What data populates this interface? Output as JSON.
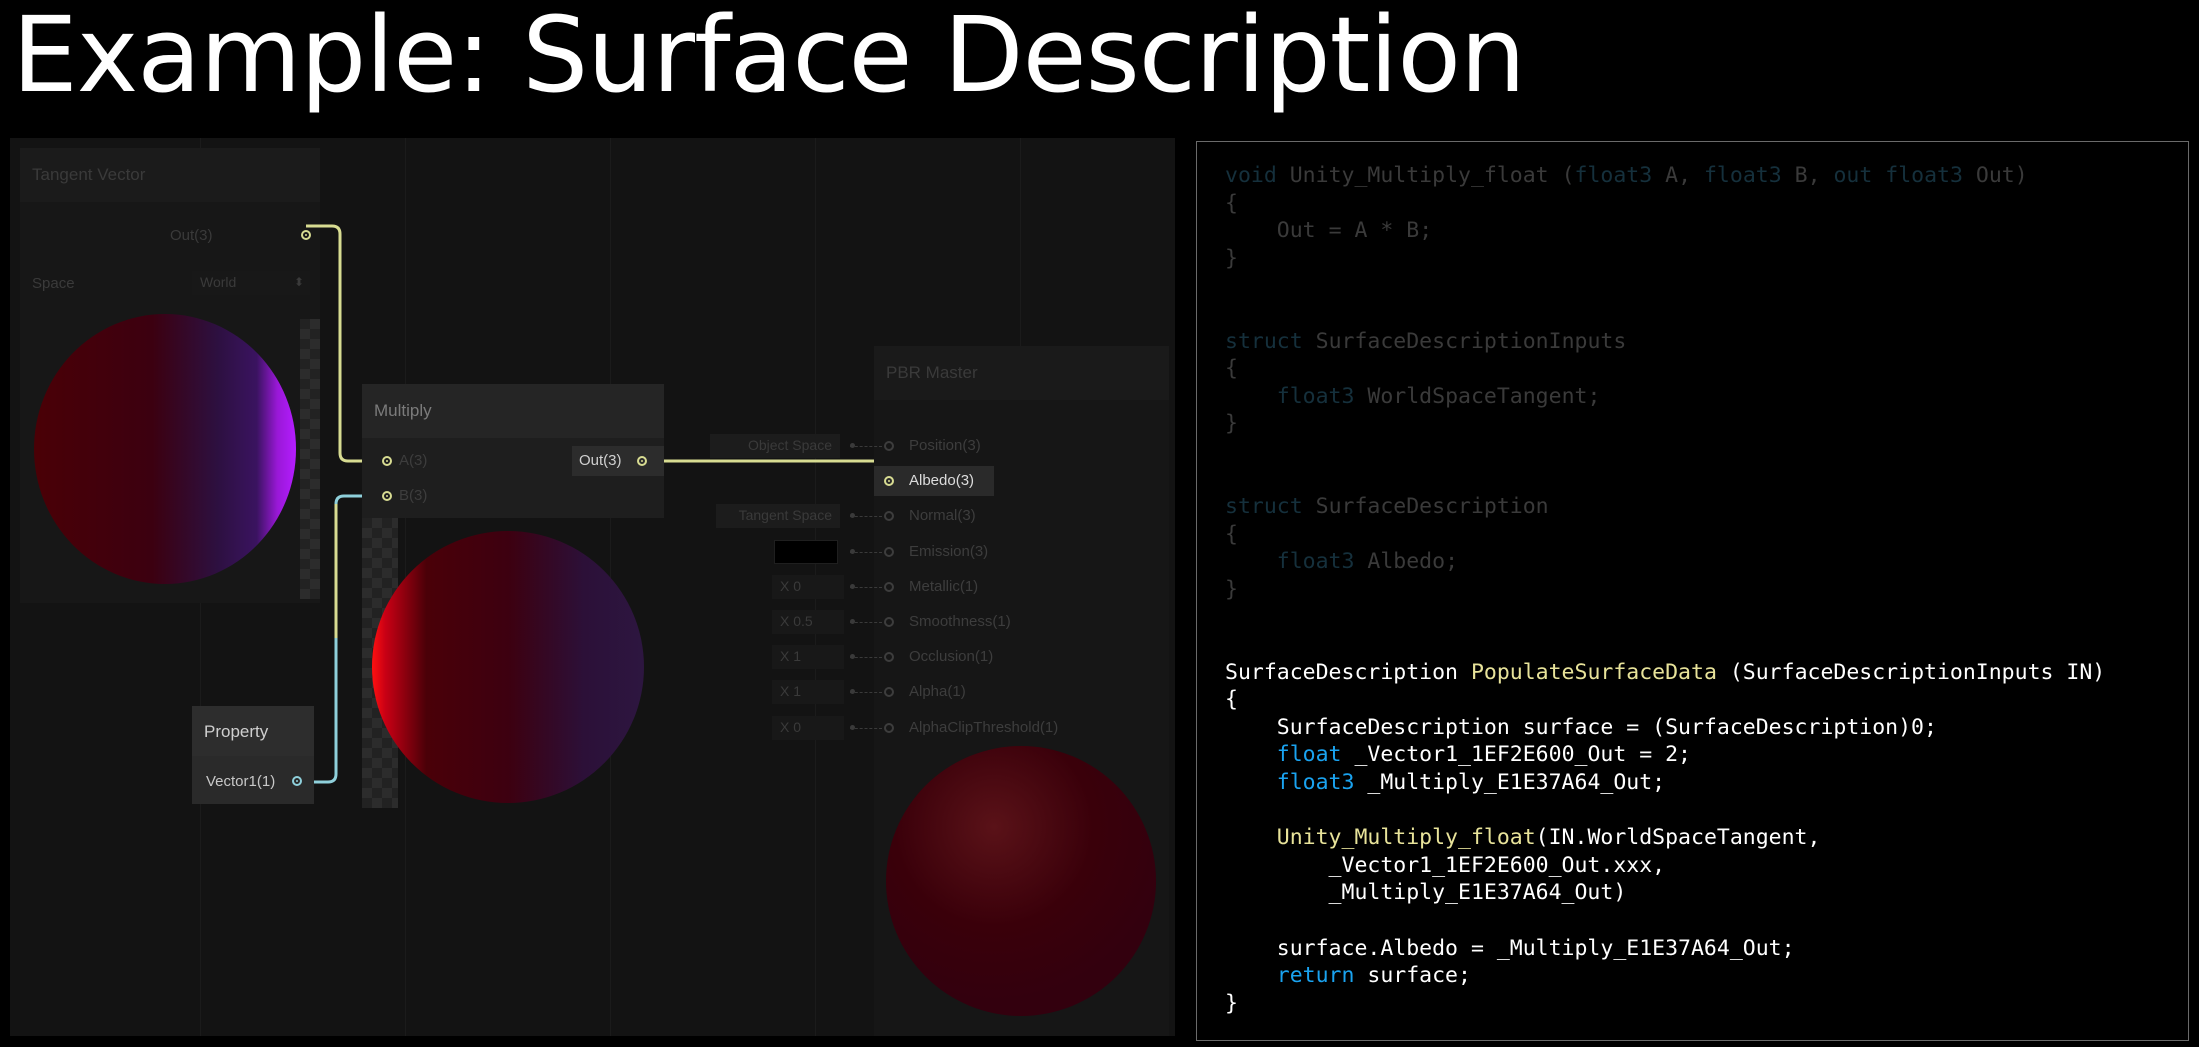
{
  "slide": {
    "title": "Example: Surface Description"
  },
  "graph": {
    "tangent_node": {
      "title": "Tangent Vector",
      "out_label": "Out(3)",
      "space_label": "Space",
      "space_value": "World"
    },
    "multiply_node": {
      "title": "Multiply",
      "in_a": "A(3)",
      "in_b": "B(3)",
      "out_label": "Out(3)"
    },
    "property_node": {
      "title": "Property",
      "out_label": "Vector1(1)"
    },
    "master_node": {
      "title": "PBR Master",
      "ports": [
        {
          "label": "Position(3)",
          "input": "Object Space"
        },
        {
          "label": "Albedo(3)",
          "input": ""
        },
        {
          "label": "Normal(3)",
          "input": "Tangent Space"
        },
        {
          "label": "Emission(3)",
          "input": ""
        },
        {
          "label": "Metallic(1)",
          "input": "X 0"
        },
        {
          "label": "Smoothness(1)",
          "input": "X 0.5"
        },
        {
          "label": "Occlusion(1)",
          "input": "X 1"
        },
        {
          "label": "Alpha(1)",
          "input": "X 1"
        },
        {
          "label": "AlphaClipThreshold(1)",
          "input": "X 0"
        }
      ]
    },
    "colors": {
      "wire_yellow": "#d8dc92",
      "wire_blue": "#8fd0db"
    }
  },
  "code": {
    "lines": [
      "void Unity_Multiply_float (float3 A, float3 B, out float3 Out)",
      "{",
      "    Out = A * B;",
      "}",
      "",
      "",
      "struct SurfaceDescriptionInputs",
      "{",
      "    float3 WorldSpaceTangent;",
      "}",
      "",
      "",
      "struct SurfaceDescription",
      "{",
      "    float3 Albedo;",
      "}",
      "",
      "",
      "SurfaceDescription PopulateSurfaceData (SurfaceDescriptionInputs IN)",
      "{",
      "    SurfaceDescription surface = (SurfaceDescription)0;",
      "    float _Vector1_1EF2E600_Out = 2;",
      "    float3 _Multiply_E1E37A64_Out;",
      "",
      "    Unity_Multiply_float(IN.WorldSpaceTangent,",
      "        _Vector1_1EF2E600_Out.xxx,",
      "        _Multiply_E1E37A64_Out)",
      "",
      "    surface.Albedo = _Multiply_E1E37A64_Out;",
      "    return surface;",
      "}"
    ],
    "colors": {
      "keyword": "#1aa3f0",
      "function": "#e8e39a",
      "faded": "#3a3a3a"
    }
  }
}
